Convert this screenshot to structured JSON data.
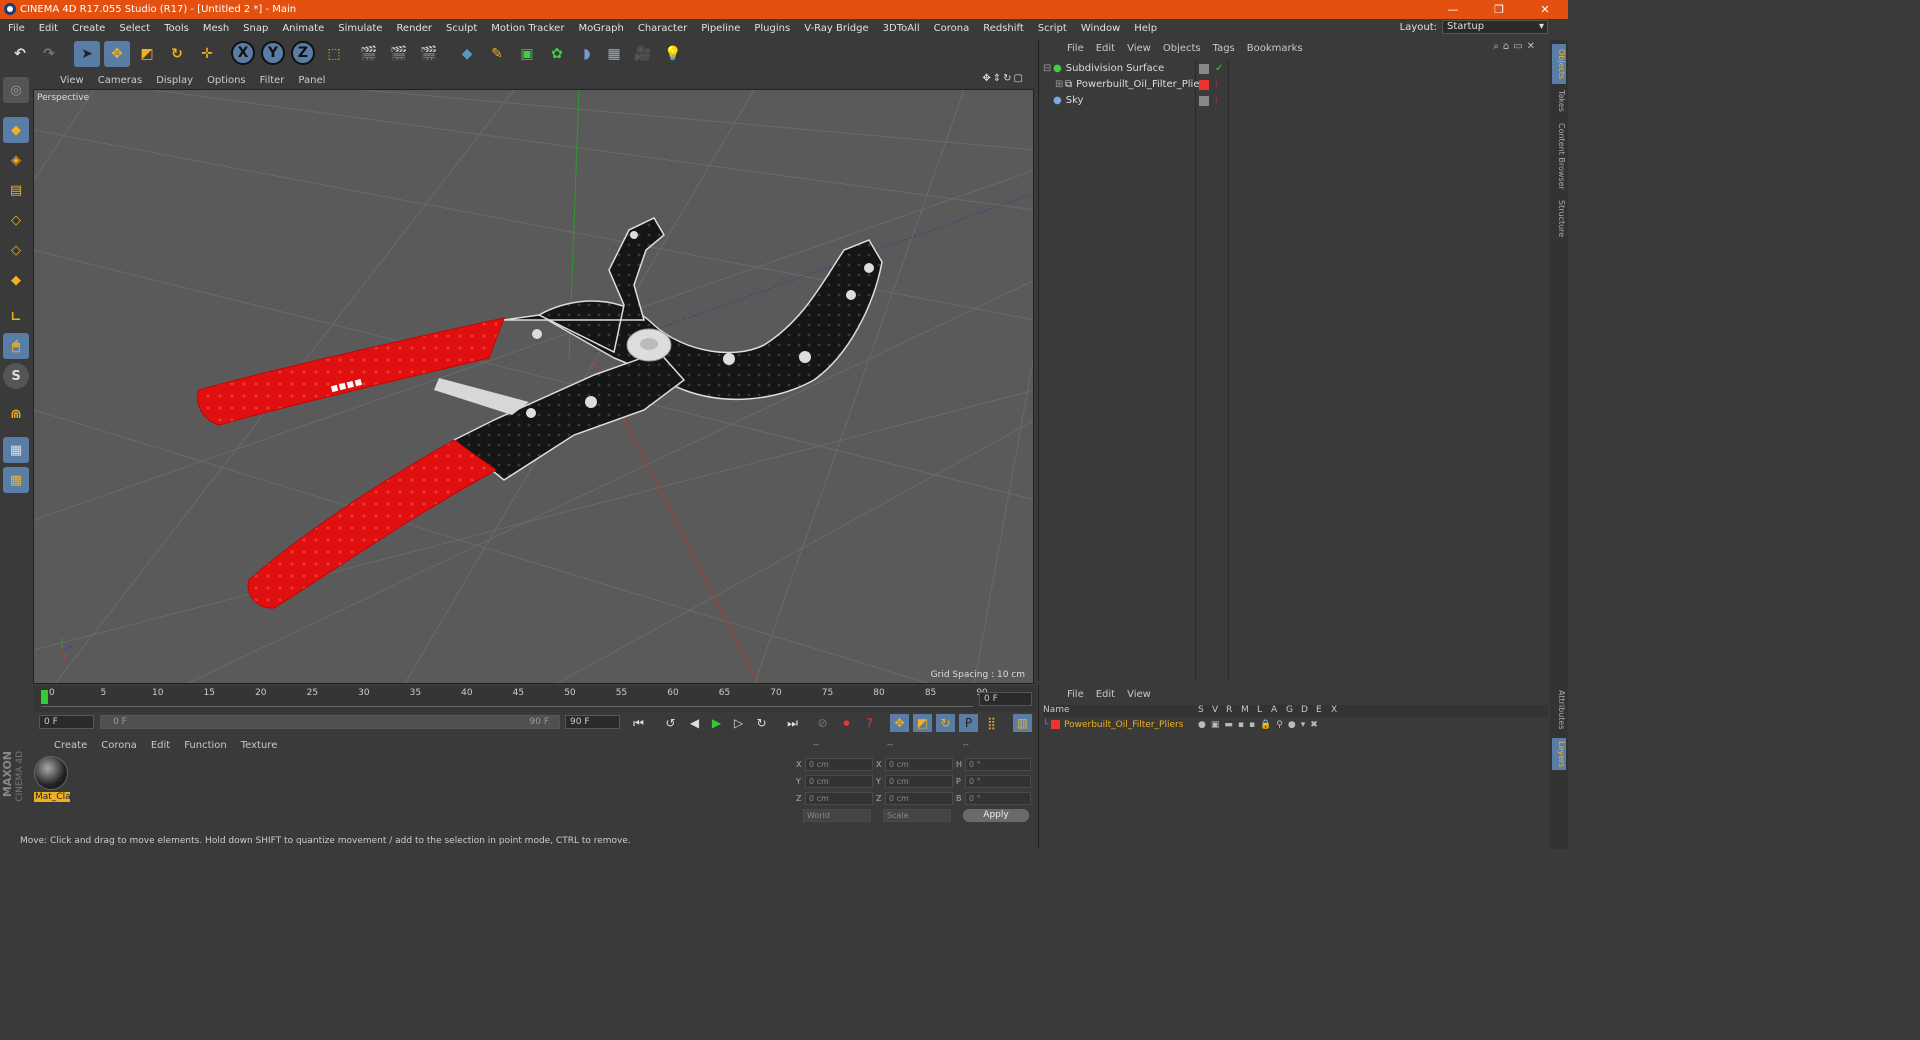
{
  "window": {
    "title": "CINEMA 4D R17.055 Studio (R17) - [Untitled 2 *] - Main"
  },
  "menubar": {
    "items": [
      "File",
      "Edit",
      "Create",
      "Select",
      "Tools",
      "Mesh",
      "Snap",
      "Animate",
      "Simulate",
      "Render",
      "Sculpt",
      "Motion Tracker",
      "MoGraph",
      "Character",
      "Pipeline",
      "Plugins",
      "V-Ray Bridge",
      "3DToAll",
      "Corona",
      "Redshift",
      "Script",
      "Window",
      "Help"
    ],
    "layout_label": "Layout:",
    "layout_value": "Startup"
  },
  "viewport": {
    "menu": [
      "View",
      "Cameras",
      "Display",
      "Options",
      "Filter",
      "Panel"
    ],
    "label": "Perspective",
    "grid_spacing": "Grid Spacing : 10 cm"
  },
  "timeline": {
    "ticks": [
      "0",
      "5",
      "10",
      "15",
      "20",
      "25",
      "30",
      "35",
      "40",
      "45",
      "50",
      "55",
      "60",
      "65",
      "70",
      "75",
      "80",
      "85",
      "90"
    ],
    "current_frame": "0 F",
    "start_field": "0 F",
    "range_start": "0 F",
    "range_end": "90 F",
    "end_field": "90 F"
  },
  "material_panel": {
    "menu": [
      "Create",
      "Corona",
      "Edit",
      "Function",
      "Texture"
    ],
    "material_name": "Mat_Cla"
  },
  "coordinates": {
    "headers": [
      "--",
      "--",
      "--"
    ],
    "rows": [
      {
        "a_label": "X",
        "a_val": "0 cm",
        "b_label": "X",
        "b_val": "0 cm",
        "c_label": "H",
        "c_val": "0 °"
      },
      {
        "a_label": "Y",
        "a_val": "0 cm",
        "b_label": "Y",
        "b_val": "0 cm",
        "c_label": "P",
        "c_val": "0 °"
      },
      {
        "a_label": "Z",
        "a_val": "0 cm",
        "b_label": "Z",
        "b_val": "0 cm",
        "c_label": "B",
        "c_val": "0 °"
      }
    ],
    "world": "World",
    "scale": "Scale",
    "apply": "Apply"
  },
  "objects_panel": {
    "menu": [
      "File",
      "Edit",
      "View",
      "Objects",
      "Tags",
      "Bookmarks"
    ],
    "items": [
      "Subdivision Surface",
      "Powerbuilt_Oil_Filter_Pliers",
      "Sky"
    ]
  },
  "layers_panel": {
    "menu": [
      "File",
      "Edit",
      "View"
    ],
    "name_header": "Name",
    "columns": [
      "S",
      "V",
      "R",
      "M",
      "L",
      "A",
      "G",
      "D",
      "E",
      "X"
    ],
    "layer_name": "Powerbuilt_Oil_Filter_Pliers"
  },
  "side_tabs": [
    "Objects",
    "Takes",
    "Content Browser",
    "Structure",
    "Attributes",
    "Layers"
  ],
  "brand": {
    "maxon": "MAXON",
    "c4d": "CINEMA 4D"
  },
  "status": "Move: Click and drag to move elements. Hold down SHIFT to quantize movement / add to the selection in point mode, CTRL to remove.",
  "colors": {
    "title_bar": "#e4500f",
    "selection": "#5a7da6",
    "pliers_handle": "#e01010"
  }
}
